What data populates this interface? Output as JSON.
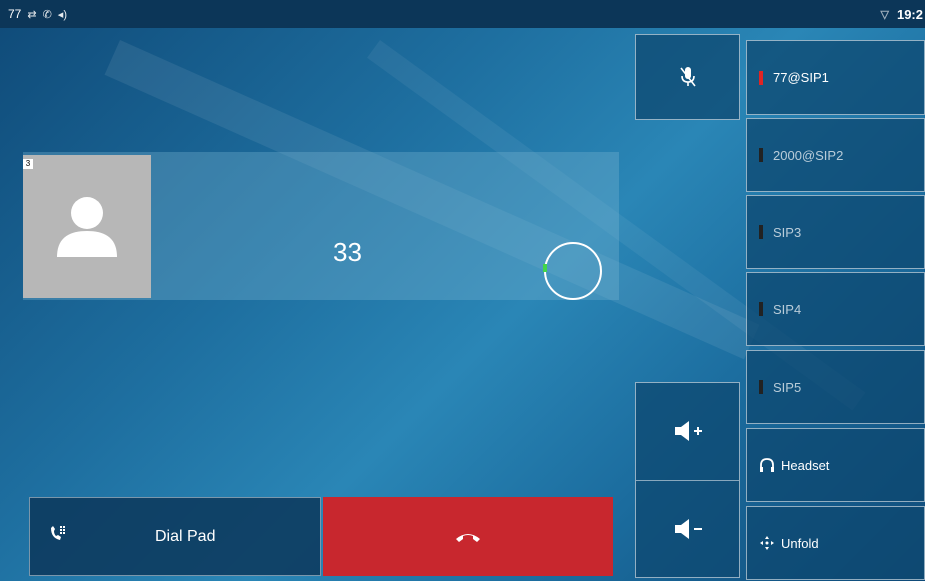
{
  "status_bar": {
    "account": "77",
    "icons": [
      "forward-icon",
      "phone-icon",
      "speaker-icon"
    ],
    "right_icon": "wifi-icon",
    "time": "19:2"
  },
  "call": {
    "caller_number": "33",
    "avatar_badge": "3"
  },
  "controls": {
    "dial_pad_label": "Dial Pad",
    "mute_icon": "mic-mute-icon",
    "hangup_icon": "hangup-icon",
    "volume_up_icon": "volume-up-icon",
    "volume_down_icon": "volume-down-icon"
  },
  "line_keys": [
    {
      "label": "77@SIP1",
      "active": true
    },
    {
      "label": "2000@SIP2",
      "active": false
    },
    {
      "label": "SIP3",
      "active": false
    },
    {
      "label": "SIP4",
      "active": false
    },
    {
      "label": "SIP5",
      "active": false
    }
  ],
  "function_keys": {
    "headset_label": "Headset",
    "unfold_label": "Unfold"
  },
  "colors": {
    "hangup": "#c8272e",
    "active_line": "#e02424",
    "ring": "#43d64a"
  }
}
